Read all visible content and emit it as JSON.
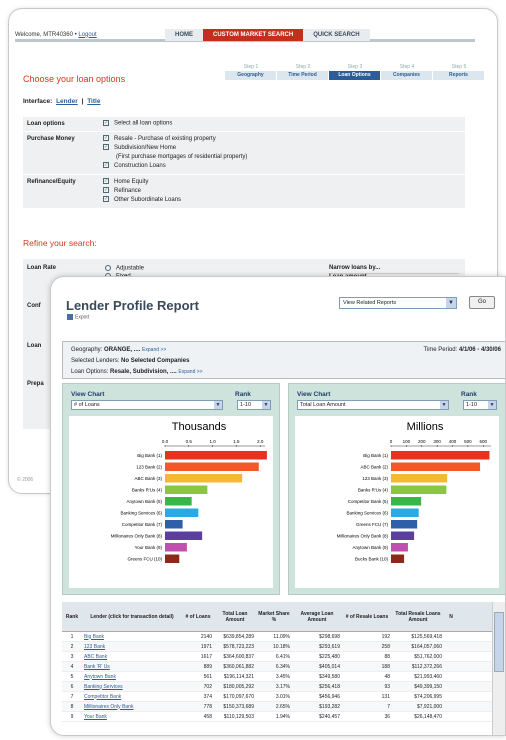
{
  "back": {
    "welcome": "Welcome, MTR40360 •",
    "logout": "Logout",
    "tabs": [
      "HOME",
      "CUSTOM MARKET SEARCH",
      "QUICK SEARCH"
    ],
    "heading": "Choose your loan options",
    "steps": [
      {
        "n": "Step 1",
        "l": "Geography"
      },
      {
        "n": "Step 2",
        "l": "Time Period"
      },
      {
        "n": "Step 3",
        "l": "Loan Options"
      },
      {
        "n": "Step 4",
        "l": "Companies"
      },
      {
        "n": "Step 5",
        "l": "Reports"
      }
    ],
    "interface_label": "Interface:",
    "iface_lender": "Lender",
    "iface_sep": "|",
    "iface_title": "Title",
    "options": [
      {
        "label": "Loan options",
        "items": [
          "Select all loan options"
        ]
      },
      {
        "label": "Purchase Money",
        "items": [
          "Resale - Purchase of existing property",
          "Subdivision/New Home",
          "(First purchase mortgages of residential property)",
          "Construction Loans"
        ]
      },
      {
        "label": "Refinance/Equity",
        "items": [
          "Home Equity",
          "Refinance",
          "Other Subordinate Loans"
        ]
      }
    ],
    "refine": "Refine your search:",
    "loan_rate": "Loan Rate",
    "rate_opts": [
      "Adjustable",
      "Fixed"
    ],
    "narrow": "Narrow loans by...",
    "loan_amount": "Loan amount",
    "side_labels": [
      "Conf",
      "Loan",
      "Prepa"
    ],
    "copyright": "© 2006"
  },
  "front": {
    "title": "Lender Profile Report",
    "export": "Export",
    "view_related": "View Related Reports",
    "go": "Go",
    "geo_label": "Geography:",
    "geo_val": "ORANGE, ....",
    "expand": "Expand >>",
    "time_label": "Time Period:",
    "time_val": "4/1/06 - 4/30/06",
    "sel_label": "Selected Lenders:",
    "sel_val": "No Selected Companies",
    "loan_label": "Loan Options:",
    "loan_val": "Resale, Subdivision, ....",
    "left": {
      "view": "View Chart",
      "rank": "Rank",
      "sel": "# of Loans",
      "ranksel": "1-10"
    },
    "right": {
      "view": "View Chart",
      "rank": "Rank",
      "sel": "Total Loan Amount",
      "ranksel": "1-10"
    },
    "cols": [
      "Rank",
      "Lender (click for transaction detail)",
      "# of Loans",
      "Total Loan Amount",
      "Market Share %",
      "Average Loan Amount",
      "# of Resale Loans",
      "Total Resale Loans Amount",
      "N"
    ],
    "rows": [
      [
        "1",
        "Big Bank",
        "2140",
        "$639,854,289",
        "11.09%",
        "$298,698",
        "192",
        "$125,569,418"
      ],
      [
        "2",
        "123 Bank",
        "1971",
        "$578,723,223",
        "10.18%",
        "$293,619",
        "258",
        "$164,057,060"
      ],
      [
        "3",
        "ABC Bank",
        "1617",
        "$364,600,837",
        "6.41%",
        "$225,480",
        "88",
        "$51,762,000"
      ],
      [
        "4",
        "Bank 'R' Us",
        "889",
        "$360,061,882",
        "6.34%",
        "$405,014",
        "188",
        "$112,372,266"
      ],
      [
        "5",
        "Anytown Bank",
        "561",
        "$196,114,321",
        "3.45%",
        "$349,580",
        "48",
        "$21,993,460"
      ],
      [
        "6",
        "Banking Services",
        "702",
        "$180,005,292",
        "3.17%",
        "$256,418",
        "93",
        "$49,399,150"
      ],
      [
        "7",
        "Competitor Bank",
        "374",
        "$170,097,670",
        "3.01%",
        "$456,946",
        "131",
        "$74,206,995"
      ],
      [
        "8",
        "Millionaires Only Bank",
        "778",
        "$150,373,689",
        "2.65%",
        "$193,282",
        "7",
        "$7,921,000"
      ],
      [
        "9",
        "Your Bank",
        "458",
        "$110,129,503",
        "1.94%",
        "$240,457",
        "36",
        "$26,148,470"
      ]
    ]
  },
  "chart_data": [
    {
      "type": "bar",
      "title": "Thousands",
      "categories": [
        "Big Bank (1)",
        "123 Bank (2)",
        "ABC Bank (3)",
        "Banks R'Us (4)",
        "Anytown Bank (5)",
        "Banking Services (6)",
        "Competitor Bank (7)",
        "Millionaires Only Bank (8)",
        "Your Bank (9)",
        "Greens FCU (10)"
      ],
      "values": [
        2.14,
        1.97,
        1.62,
        0.89,
        0.56,
        0.7,
        0.37,
        0.78,
        0.46,
        0.3
      ],
      "xticks": [
        "0.0",
        "0.5",
        "1.0",
        "1.5",
        "2.0"
      ],
      "xlim": [
        0,
        2.1
      ],
      "colors": [
        "#e8321e",
        "#f15a24",
        "#f7b733",
        "#8cc63f",
        "#39b54a",
        "#29abe2",
        "#2e5fa8",
        "#5b3fa0",
        "#c04fb0",
        "#8c2a1a"
      ]
    },
    {
      "type": "bar",
      "title": "Millions",
      "categories": [
        "Big Bank (1)",
        "ABC Bank (2)",
        "123 Bank (3)",
        "Banks R'Us (4)",
        "Competitor Bank (5)",
        "Banking Services (6)",
        "Greens FCU (7)",
        "Millionaires Only Bank (8)",
        "Anytown Bank (9)",
        "Bucks Bank (10)"
      ],
      "values": [
        640,
        579,
        365,
        360,
        196,
        180,
        170,
        150,
        110,
        85
      ],
      "xticks": [
        "0",
        "100",
        "200",
        "300",
        "400",
        "500",
        "600"
      ],
      "xlim": [
        0,
        650
      ],
      "colors": [
        "#e8321e",
        "#f15a24",
        "#f7b733",
        "#8cc63f",
        "#39b54a",
        "#29abe2",
        "#2e5fa8",
        "#5b3fa0",
        "#c04fb0",
        "#8c2a1a"
      ]
    }
  ]
}
